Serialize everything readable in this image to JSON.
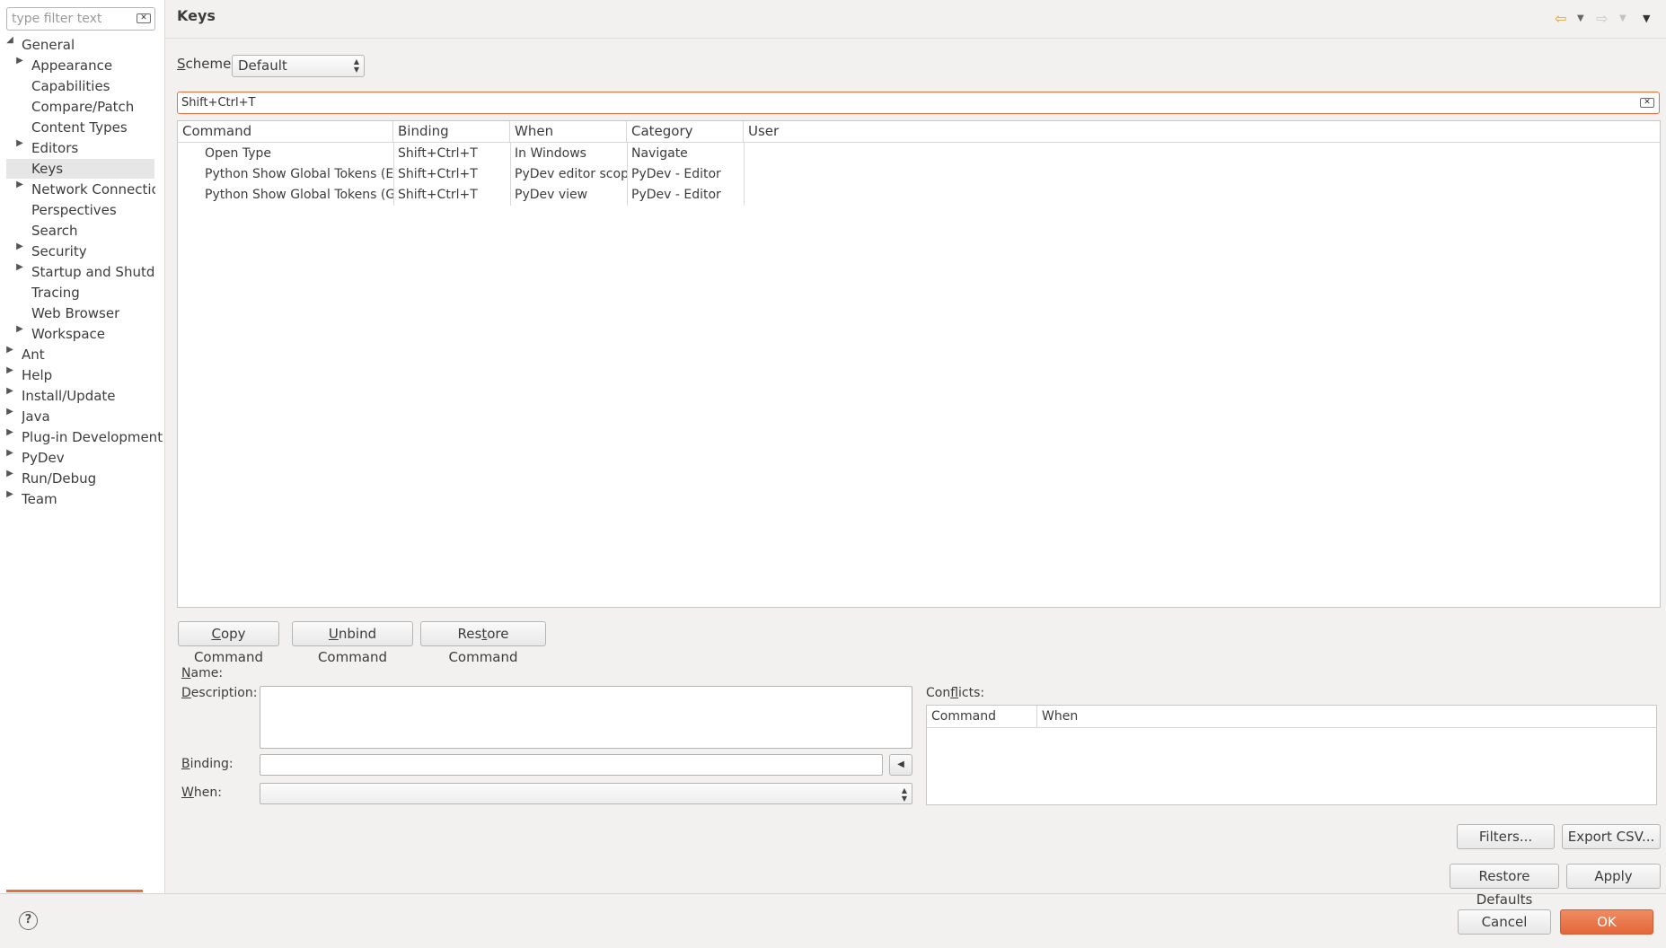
{
  "sidebar": {
    "filter_placeholder": "type filter text",
    "items": [
      {
        "label": "General",
        "expanded": true
      },
      {
        "label": "Appearance"
      },
      {
        "label": "Capabilities"
      },
      {
        "label": "Compare/Patch"
      },
      {
        "label": "Content Types"
      },
      {
        "label": "Editors"
      },
      {
        "label": "Keys",
        "selected": true
      },
      {
        "label": "Network Connection"
      },
      {
        "label": "Perspectives"
      },
      {
        "label": "Search"
      },
      {
        "label": "Security"
      },
      {
        "label": "Startup and Shutdow"
      },
      {
        "label": "Tracing"
      },
      {
        "label": "Web Browser"
      },
      {
        "label": "Workspace"
      },
      {
        "label": "Ant"
      },
      {
        "label": "Help"
      },
      {
        "label": "Install/Update"
      },
      {
        "label": "Java"
      },
      {
        "label": "Plug-in Development"
      },
      {
        "label": "PyDev"
      },
      {
        "label": "Run/Debug"
      },
      {
        "label": "Team"
      }
    ]
  },
  "page": {
    "title": "Keys"
  },
  "scheme": {
    "label_u": "S",
    "label_rest": "cheme:",
    "value": "Default"
  },
  "search": {
    "value": "Shift+Ctrl+T"
  },
  "table": {
    "headers": [
      "Command",
      "Binding",
      "When",
      "Category",
      "User"
    ],
    "rows": [
      [
        "Open Type",
        "Shift+Ctrl+T",
        "In Windows",
        "Navigate",
        ""
      ],
      [
        "Python Show Global Tokens (Ed",
        "Shift+Ctrl+T",
        "PyDev editor scope",
        "PyDev - Editor",
        ""
      ],
      [
        "Python Show Global Tokens (Gl",
        "Shift+Ctrl+T",
        "PyDev view",
        "PyDev - Editor",
        ""
      ]
    ]
  },
  "actions": {
    "copy_u": "C",
    "copy_rest": "opy Command",
    "unbind_u": "U",
    "unbind_rest": "nbind Command",
    "restore_pre": "Res",
    "restore_u": "t",
    "restore_rest": "ore Command"
  },
  "details": {
    "name_u": "N",
    "name_rest": "ame:",
    "description_u": "D",
    "description_rest": "escription:",
    "binding_u": "B",
    "binding_rest": "inding:",
    "when_u": "W",
    "when_rest": "hen:",
    "conflicts_pre": "Con",
    "conflicts_u": "f",
    "conflicts_rest": "licts:",
    "conflicts_headers": [
      "Command",
      "When"
    ]
  },
  "buttons": {
    "filters": "Filters...",
    "export_csv": "Export CSV...",
    "restore_defaults": "Restore Defaults",
    "apply": "Apply",
    "cancel": "Cancel",
    "ok": "OK"
  },
  "icons": {
    "back": "back-arrow-icon",
    "forward": "forward-arrow-icon",
    "menu": "view-menu-icon",
    "help": "help-icon"
  },
  "colors": {
    "accent": "#e96f3f",
    "ok_button": "#e4673a",
    "selection": "#e6e6e6"
  }
}
